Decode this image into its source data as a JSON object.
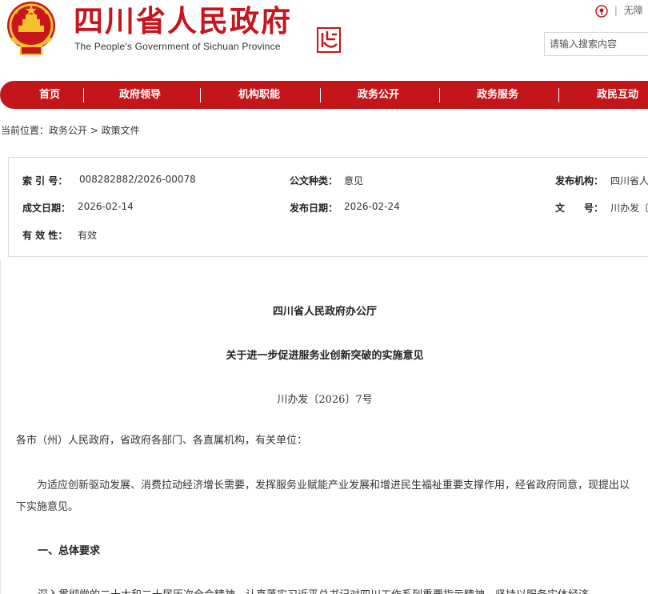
{
  "header": {
    "site_title": "四川省人民政府",
    "site_subtitle": "The People's Government of Sichuan Province",
    "top_right_link": "无障",
    "search_placeholder": "请输入搜索内容"
  },
  "nav": {
    "items": [
      {
        "label": "首页"
      },
      {
        "label": "政府领导"
      },
      {
        "label": "机构职能"
      },
      {
        "label": "政务公开"
      },
      {
        "label": "政务服务"
      },
      {
        "label": "政民互动"
      }
    ]
  },
  "breadcrumb": "当前位置：政务公开 > 政策文件",
  "meta": {
    "index_label": "索 引 号：",
    "index_value": "008282882/2026-00078",
    "category_label": "公文种类：",
    "category_value": "意见",
    "publisher_label": "发布机构：",
    "publisher_value": "四川省人",
    "written_label": "成文日期：",
    "written_value": "2026-02-14",
    "published_label": "发布日期：",
    "published_value": "2026-02-24",
    "docno_label": "文　　号：",
    "docno_value": "川办发〔",
    "validity_label": "有 效 性：",
    "validity_value": "有效"
  },
  "document": {
    "issuer": "四川省人民政府办公厅",
    "title": "关于进一步促进服务业创新突破的实施意见",
    "doc_number": "川办发〔2026〕7号",
    "salutation": "各市（州）人民政府，省政府各部门、各直属机构，有关单位：",
    "intro": "为适应创新驱动发展、消费拉动经济增长需要，发挥服务业赋能产业发展和增进民生福祉重要支撑作用，经省政府同意，现提出以下实施意见。",
    "section1_heading": "一、总体要求",
    "section1_text": "深入贯彻党的二十大和二十届历次全会精神，认真落实习近平总书记对四川工作系列重要指示精神，坚持以服务实体经济"
  },
  "colors": {
    "brand_red": "#c4161c",
    "nav_red": "#c2161b",
    "emblem_gold": "#f3c12b"
  }
}
